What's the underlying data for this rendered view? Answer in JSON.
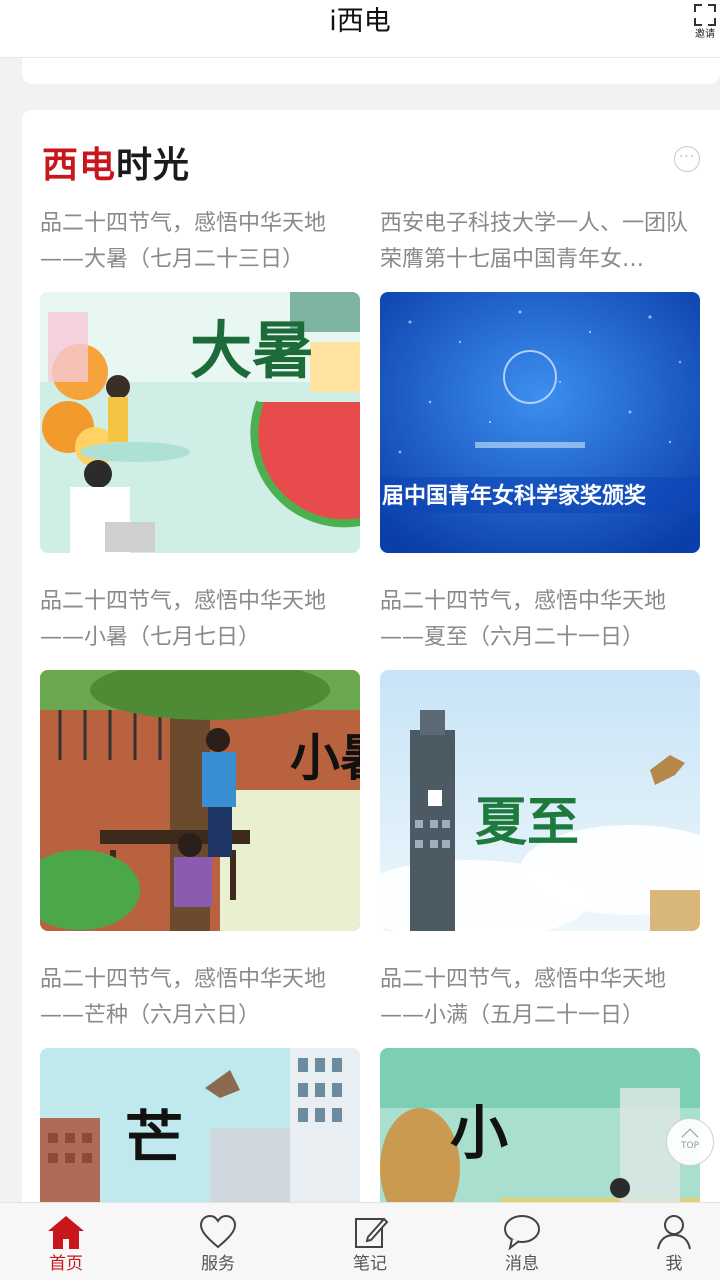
{
  "header": {
    "title": "i西电",
    "invite_label": "邀请"
  },
  "section": {
    "title_red": "西电",
    "title_black": "时光",
    "more_icon": "ellipsis-circle-icon"
  },
  "articles": [
    {
      "title": "品二十四节气，感悟中华天地——大暑（七月二十三日）",
      "image": "dashu-illustration",
      "overlay_text": "大暑"
    },
    {
      "title": "西安电子科技大学一人、一团队荣膺第十七届中国青年女…",
      "image": "award-ceremony-stage",
      "overlay_text": "届中国青年女科学家奖颁奖"
    },
    {
      "title": "品二十四节气，感悟中华天地——小暑（七月七日）",
      "image": "xiaoshu-illustration",
      "overlay_text": "小暑"
    },
    {
      "title": "品二十四节气，感悟中华天地——夏至（六月二十一日）",
      "image": "xiazhi-illustration",
      "overlay_text": "夏至"
    },
    {
      "title": "品二十四节气，感悟中华天地——芒种（六月六日）",
      "image": "mangzhong-illustration",
      "overlay_text": "芒"
    },
    {
      "title": "品二十四节气，感悟中华天地——小满（五月二十一日）",
      "image": "xiaoman-illustration",
      "overlay_text": "小"
    }
  ],
  "back_to_top": {
    "label": "TOP"
  },
  "tabbar": {
    "items": [
      {
        "label": "首页",
        "icon": "home-icon",
        "active": true
      },
      {
        "label": "服务",
        "icon": "heart-icon",
        "active": false
      },
      {
        "label": "笔记",
        "icon": "edit-note-icon",
        "active": false
      },
      {
        "label": "消息",
        "icon": "chat-bubble-icon",
        "active": false
      },
      {
        "label": "我",
        "icon": "user-icon",
        "active": false
      }
    ]
  },
  "colors": {
    "accent": "#c8161d",
    "caption": "#8a8a8a",
    "background": "#f2f2f5"
  }
}
